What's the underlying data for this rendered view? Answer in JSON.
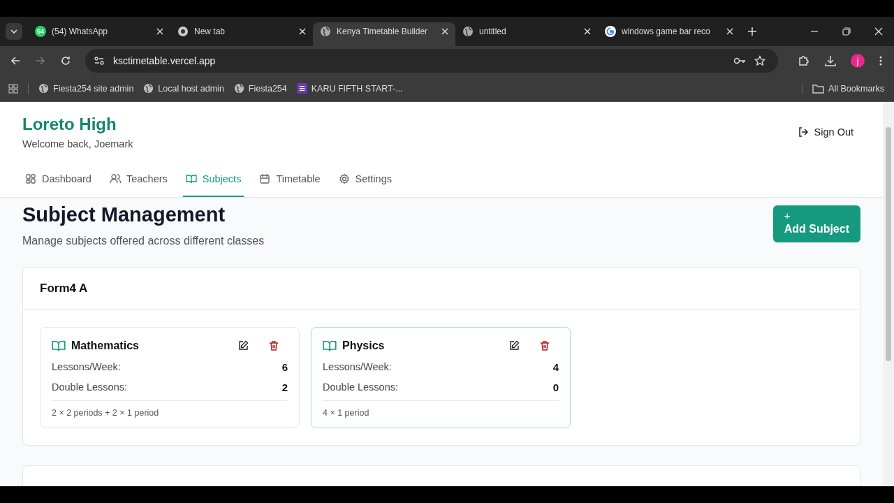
{
  "browser": {
    "tabs": [
      {
        "title": "(54) WhatsApp",
        "badge": "54",
        "kind": "whatsapp",
        "selected": false
      },
      {
        "title": "New tab",
        "kind": "chrome",
        "selected": false
      },
      {
        "title": "Kenya Timetable Builder",
        "kind": "globe",
        "selected": true
      },
      {
        "title": "untitled",
        "kind": "globe",
        "selected": false
      },
      {
        "title": "windows game bar reco",
        "kind": "google",
        "selected": false
      }
    ],
    "address": "ksctimetable.vercel.app",
    "profile": "j",
    "bookmarks": [
      {
        "label": "Fiesta254 site admin",
        "kind": "globe"
      },
      {
        "label": "Local host admin",
        "kind": "globe"
      },
      {
        "label": "Fiesta254",
        "kind": "globe"
      },
      {
        "label": "KARU FIFTH START-...",
        "kind": "form"
      }
    ],
    "all_bookmarks": "All Bookmarks"
  },
  "header": {
    "school": "Loreto High",
    "welcome": "Welcome back, Joemark",
    "sign_out": "Sign Out"
  },
  "nav": [
    {
      "label": "Dashboard",
      "kind": "grid",
      "selected": false
    },
    {
      "label": "Teachers",
      "kind": "users",
      "selected": false
    },
    {
      "label": "Subjects",
      "kind": "book",
      "selected": true
    },
    {
      "label": "Timetable",
      "kind": "calendar",
      "selected": false
    },
    {
      "label": "Settings",
      "kind": "gear",
      "selected": false
    }
  ],
  "page": {
    "title": "Subject Management",
    "subtitle": "Manage subjects offered across different classes",
    "add_button": {
      "icon": "+",
      "label": "Add Subject"
    }
  },
  "classes": [
    {
      "name": "Form4 A",
      "subjects": [
        {
          "name": "Mathematics",
          "lessons_label": "Lessons/Week:",
          "lessons": "6",
          "double_label": "Double Lessons:",
          "doubles": "2",
          "summary": "2 × 2 periods + 2 × 1 period",
          "highlighted": false
        },
        {
          "name": "Physics",
          "lessons_label": "Lessons/Week:",
          "lessons": "4",
          "double_label": "Double Lessons:",
          "doubles": "0",
          "summary": "4 × 1 period",
          "highlighted": true
        }
      ]
    }
  ]
}
